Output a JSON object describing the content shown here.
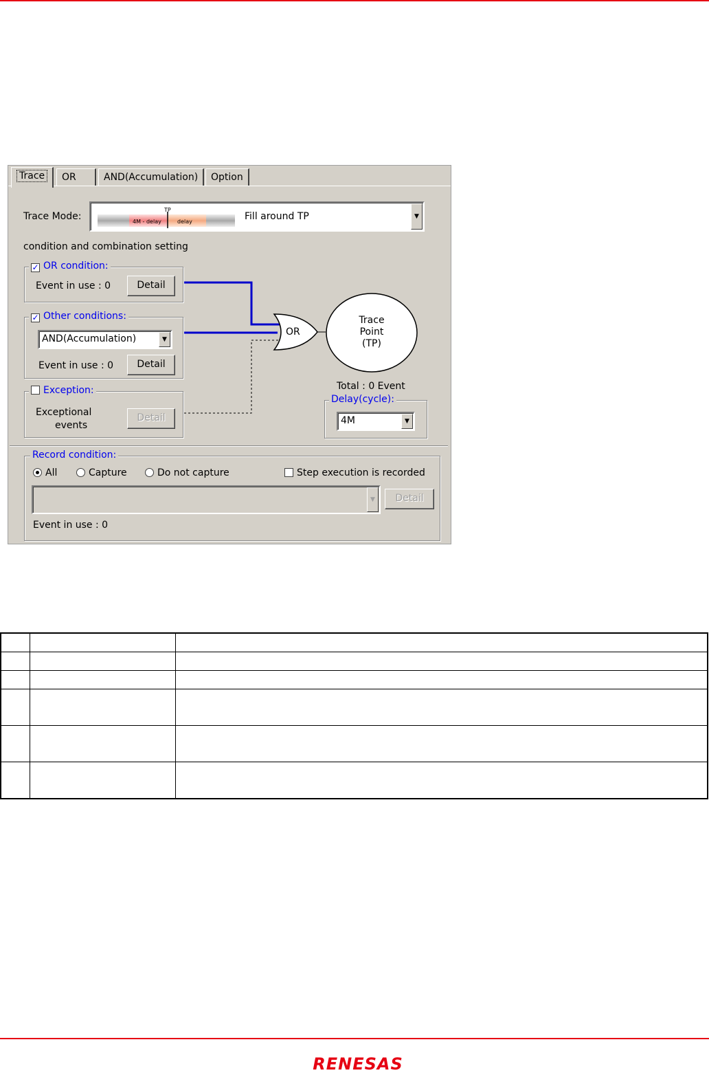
{
  "tabs": [
    "Trace",
    "OR",
    "AND(Accumulation)",
    "Option"
  ],
  "trace_mode": {
    "label": "Trace Mode:",
    "value": "Fill around TP",
    "diagram": {
      "tp": "TP",
      "left": "4M - delay",
      "right": "delay"
    }
  },
  "combination_heading": "condition and combination setting",
  "or_condition": {
    "label": "OR condition:",
    "checked": true,
    "event_in_use": "Event in use :  0",
    "detail": "Detail"
  },
  "other_conditions": {
    "label": "Other conditions:",
    "checked": true,
    "select": "AND(Accumulation)",
    "event_in_use": "Event in use : 0",
    "detail": "Detail"
  },
  "exception": {
    "label": "Exception:",
    "checked": false,
    "text_line1": "Exceptional",
    "text_line2": "events",
    "detail": "Detail"
  },
  "gate_label": "OR",
  "trace_point": {
    "line1": "Trace",
    "line2": "Point",
    "line3": "(TP)"
  },
  "total": "Total :  0   Event",
  "delay": {
    "label": "Delay(cycle):",
    "value": "4M"
  },
  "record": {
    "label": "Record condition:",
    "options": [
      "All",
      "Capture",
      "Do not capture"
    ],
    "selected": "All",
    "step_label": "Step execution is recorded",
    "step_checked": false,
    "detail": "Detail",
    "event_in_use": "Event in use : 0"
  },
  "logo": "RENESAS",
  "colors": {
    "brand_red": "#e60012",
    "label_blue": "#0000ee",
    "wire_blue": "#0000cc"
  }
}
